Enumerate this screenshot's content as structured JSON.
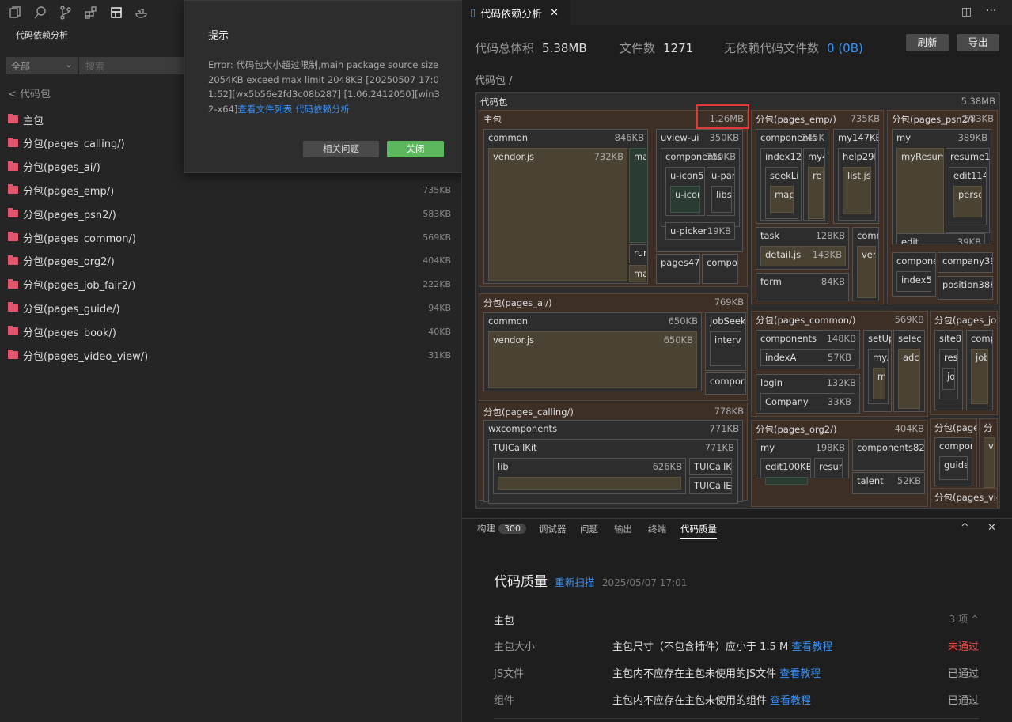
{
  "left_panel": {
    "title": "代码依赖分析",
    "filter_value": "全部",
    "search_placeholder": "搜索",
    "back_label": "< 代码包",
    "packages": [
      {
        "name": "主包",
        "size": ""
      },
      {
        "name": "分包(pages_calling/)",
        "size": ""
      },
      {
        "name": "分包(pages_ai/)",
        "size": ""
      },
      {
        "name": "分包(pages_emp/)",
        "size": "735KB"
      },
      {
        "name": "分包(pages_psn2/)",
        "size": "583KB"
      },
      {
        "name": "分包(pages_common/)",
        "size": "569KB"
      },
      {
        "name": "分包(pages_org2/)",
        "size": "404KB"
      },
      {
        "name": "分包(pages_job_fair2/)",
        "size": "222KB"
      },
      {
        "name": "分包(pages_guide/)",
        "size": "94KB"
      },
      {
        "name": "分包(pages_book/)",
        "size": "40KB"
      },
      {
        "name": "分包(pages_video_view/)",
        "size": "31KB"
      }
    ]
  },
  "dialog": {
    "title": "提示",
    "message": "Error: 代码包大小超过限制,main package source size 2054KB exceed max limit 2048KB [20250507 17:01:52][wx5b56e2fd3c08b287] [1.06.2412050][win32-x64]",
    "link1": "查看文件列表",
    "link2": "代码依赖分析",
    "btn_related": "相关问题",
    "btn_close": "关闭"
  },
  "editor": {
    "tab_label": "代码依赖分析",
    "stats": {
      "total_label": "代码总体积",
      "total_value": "5.38MB",
      "files_label": "文件数",
      "files_value": "1271",
      "nodep_label": "无依赖代码文件数",
      "nodep_value": "0 (0B)"
    },
    "btn_refresh": "刷新",
    "btn_export": "导出",
    "breadcrumb": "代码包 /",
    "treemap": {
      "root_label": "代码包",
      "root_size": "5.38MB",
      "main_label": "主包",
      "main_size": "1.26MB",
      "common_label": "common",
      "common_size": "846KB",
      "vendor_label": "vendor.js",
      "vendor_size": "732KB",
      "mai_label": "mai",
      "runt_label": "runt",
      "mai2_label": "mai",
      "uview_label": "uview-ui",
      "uview_size": "350KB",
      "components_label": "components",
      "components_size": "350KB",
      "uicon_label": "u-icon54",
      "upar_label": "u-par",
      "uicon2_label": "u-icor",
      "libs_label": "libs",
      "upicker_label": "u-picker",
      "upicker_size": "19KB",
      "pages_label": "pages47K",
      "compo_label": "compo",
      "emp_label": "分包(pages_emp/)",
      "emp_size": "735KB",
      "emp_comp_label": "components",
      "emp_comp_size": "245K",
      "index127_label": "index127",
      "my4_label": "my4",
      "seekliv_label": "seekLiv",
      "re_label": "re",
      "map_label": "map",
      "my147_label": "my147KB",
      "help_label": "help29K",
      "listjs_label": "list.js1",
      "task_label": "task",
      "task_size": "128KB",
      "detail_label": "detail.js",
      "detail_size": "143KB",
      "comm_label": "comm",
      "ver_label": "ver",
      "form_label": "form",
      "form_size": "84KB",
      "psn_label": "分包(pages_psn2/)",
      "psn_size": "583KB",
      "psn_my_label": "my",
      "psn_my_size": "389KB",
      "myresum_label": "myResum",
      "resume13_label": "resume13",
      "edit114_label": "edit114",
      "perso_label": "perso",
      "edit_label": "edit",
      "edit_size": "39KB",
      "compone_label": "compone",
      "company39_label": "company39",
      "index59_label": "index59",
      "position38_label": "position38K",
      "ai_label": "分包(pages_ai/)",
      "ai_size": "769KB",
      "ai_common_label": "common",
      "ai_common_size": "650KB",
      "ai_vendor_label": "vendor.js",
      "ai_vendor_size": "650KB",
      "jobseek_label": "jobSeek",
      "interv_label": "interv",
      "ai_compo_label": "compor",
      "pcommon_label": "分包(pages_common/)",
      "pcommon_size": "569KB",
      "pc_comp_label": "components",
      "pc_comp_size": "148KB",
      "indexa_label": "indexA",
      "indexa_size": "57KB",
      "setup_label": "setUp",
      "selec_label": "selec",
      "mya_label": "myA",
      "m_label": "m",
      "adc_label": "adc",
      "login_label": "login",
      "login_size": "132KB",
      "company_label": "Company",
      "company_size": "33KB",
      "jobf_label": "分包(pages_job",
      "site_label": "site82",
      "comp2_label": "comp",
      "rese_label": "rese",
      "jo_label": "jo",
      "job_label": "job",
      "calling_label": "分包(pages_calling/)",
      "calling_size": "778KB",
      "wxc_label": "wxcomponents",
      "wxc_size": "771KB",
      "tuick_label": "TUICallKit",
      "tuick_size": "771KB",
      "lib_label": "lib",
      "lib_size": "626KB",
      "tuick2_label": "TUICallK",
      "tuice_label": "TUICallE",
      "org_label": "分包(pages_org2/)",
      "org_size": "404KB",
      "org_my_label": "my",
      "org_my_size": "198KB",
      "org_comp_label": "components82K",
      "edit100_label": "edit100KB",
      "resum_label": "resum",
      "talent_label": "talent",
      "talent_size": "52KB",
      "guide_pkg_label": "分包(page",
      "guide_pkg2_label": "分",
      "guide_comp_label": "compor",
      "guide_label": "guide",
      "v_label": "v",
      "video_label": "分包(pages_vid"
    },
    "bottom_tabs": [
      "构建",
      "调试器",
      "问题",
      "输出",
      "终端",
      "代码质量"
    ],
    "build_count": "300",
    "quality": {
      "title": "代码质量",
      "rescan": "重新扫描",
      "time": "2025/05/07 17:01",
      "section": "主包",
      "section_count": "3 项",
      "rows": [
        {
          "name": "主包大小",
          "desc": "主包尺寸（不包含插件）应小于 1.5 M",
          "link": "查看教程",
          "status": "未通过"
        },
        {
          "name": "JS文件",
          "desc": "主包内不应存在主包未使用的JS文件",
          "link": "查看教程",
          "status": "已通过"
        },
        {
          "name": "组件",
          "desc": "主包内不应存在主包未使用的组件",
          "link": "查看教程",
          "status": "已通过"
        }
      ]
    },
    "colors": {
      "accent": "#3794ff",
      "fail": "#f14c4c",
      "close_btn": "#5cb85c",
      "highlight": "#e53935"
    }
  }
}
